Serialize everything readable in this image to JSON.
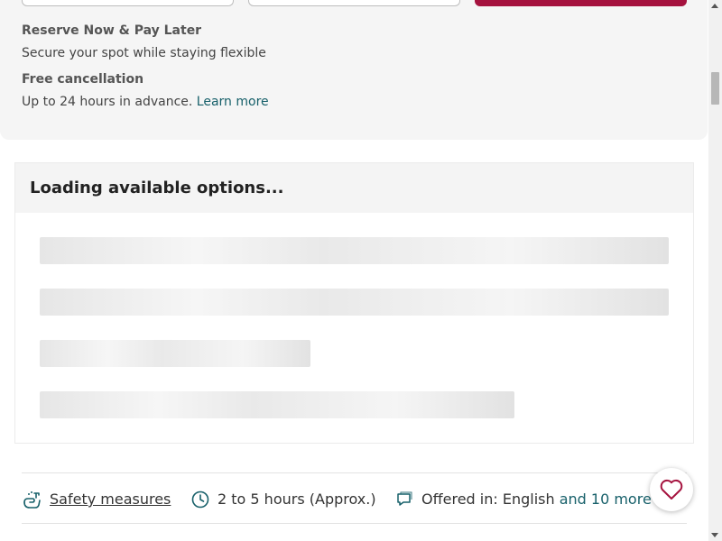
{
  "booking": {
    "benefits": [
      {
        "title": "Reserve Now & Pay Later",
        "text": "Secure your spot while staying flexible"
      },
      {
        "title": "Free cancellation",
        "text": "Up to 24 hours in advance.",
        "link": "Learn more"
      }
    ]
  },
  "options": {
    "title": "Loading available options..."
  },
  "info": {
    "safety": "Safety measures",
    "duration": "2 to 5 hours (Approx.)",
    "language_prefix": "Offered in: English",
    "language_more": "and 10 more"
  },
  "colors": {
    "brand": "#a5123e",
    "accent": "#17606a"
  },
  "icons": {
    "safety": "hand-sanitizer-icon",
    "duration": "clock-icon",
    "language": "speech-bubble-icon",
    "wishlist": "heart-icon"
  }
}
